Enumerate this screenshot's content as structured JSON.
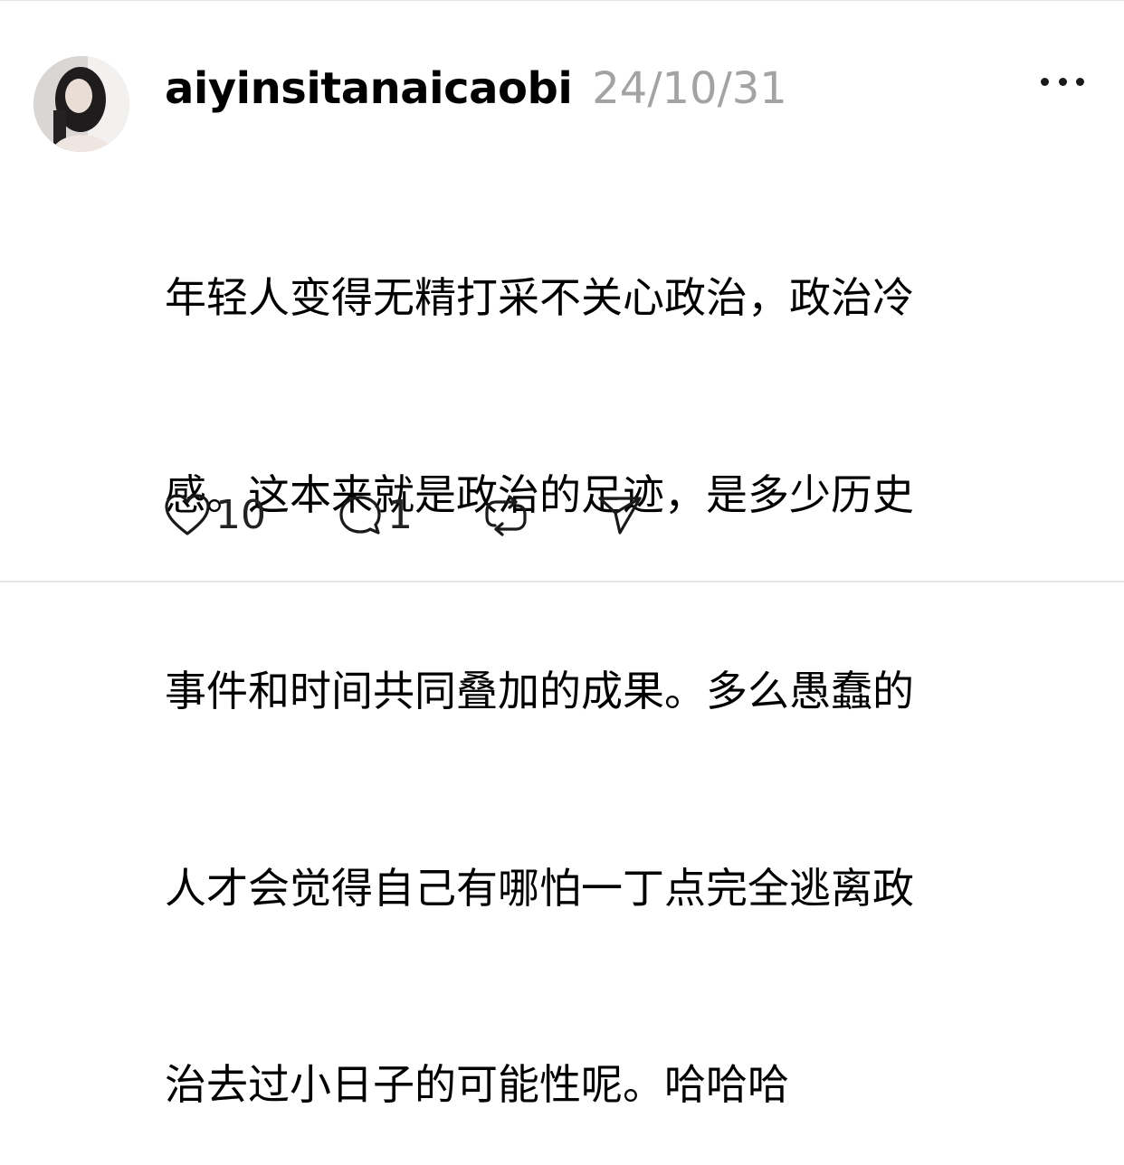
{
  "post": {
    "username": "aiyinsitanaicaobi",
    "timestamp": "24/10/31",
    "text_lines": [
      "年轻人变得无精打采不关心政治，政治冷",
      "感。这本来就是政治的足迹，是多少历史",
      "事件和时间共同叠加的成果。多么愚蠢的",
      "人才会觉得自己有哪怕一丁点完全逃离政",
      "治去过小日子的可能性呢。哈哈哈"
    ]
  },
  "actions": {
    "like_count": "10",
    "reply_count": "1"
  },
  "icons": {
    "like": "heart-icon",
    "reply": "comment-bubble-icon",
    "repost": "repost-icon",
    "share": "send-icon",
    "more": "more-dots-icon"
  },
  "colors": {
    "username": "#000000",
    "timestamp": "#a3a3a3",
    "icon": "#1a1a1a"
  }
}
